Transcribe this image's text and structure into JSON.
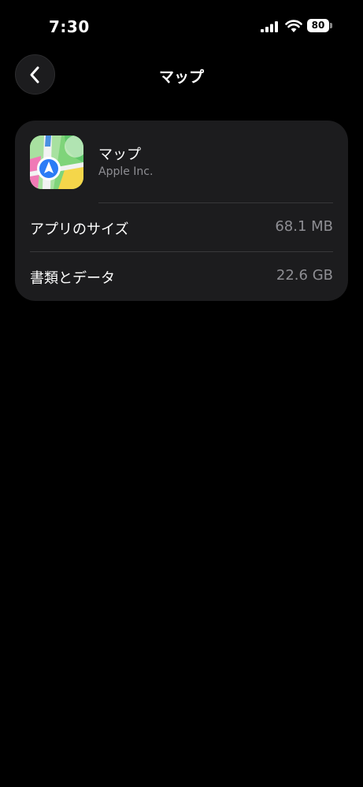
{
  "status_bar": {
    "time": "7:30",
    "battery": "80",
    "icons": [
      "signal-icon",
      "wifi-icon",
      "battery-icon"
    ]
  },
  "nav": {
    "title": "マップ",
    "back_icon": "chevron-left-icon"
  },
  "app": {
    "name": "マップ",
    "developer": "Apple Inc.",
    "icon": "maps-app-icon"
  },
  "rows": [
    {
      "label": "アプリのサイズ",
      "value": "68.1 MB"
    },
    {
      "label": "書類とデータ",
      "value": "22.6 GB"
    }
  ],
  "colors": {
    "background": "#000000",
    "card": "#1c1c1e",
    "secondary_text": "#8e8e93",
    "divider": "#38383a"
  }
}
